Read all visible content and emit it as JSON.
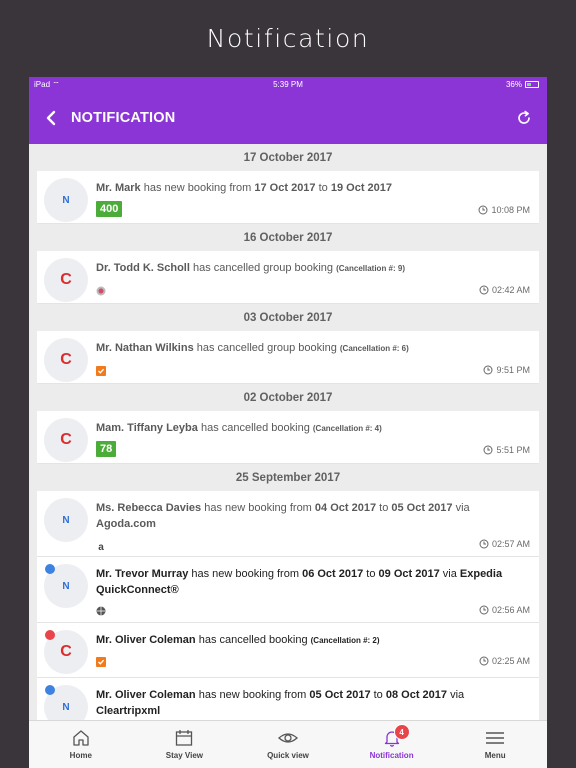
{
  "page_heading": "Notification",
  "status_bar": {
    "device": "iPad",
    "time": "5:39 PM",
    "battery": "36%"
  },
  "app_bar": {
    "title": "NOTIFICATION"
  },
  "groups": [
    {
      "date": "17 October 2017"
    },
    {
      "date": "16 October 2017"
    },
    {
      "date": "03 October 2017"
    },
    {
      "date": "02 October 2017"
    },
    {
      "date": "25 September 2017"
    }
  ],
  "notifications": [
    {
      "initial": "N",
      "name": "Mr. Mark",
      "text1": "has new booking from",
      "from": "17 Oct 2017",
      "to_word": "to",
      "to": "19 Oct 2017",
      "badge": "400",
      "time": "10:08 PM"
    },
    {
      "initial": "C",
      "name": "Dr. Todd K. Scholl",
      "text1": "has cancelled group booking",
      "cancel": "(Cancellation #: 9)",
      "time": "02:42 AM",
      "source_icon": "booking-engine-icon"
    },
    {
      "initial": "C",
      "name": "Mr. Nathan Wilkins",
      "text1": "has cancelled group booking",
      "cancel": "(Cancellation #: 6)",
      "time": "9:51 PM",
      "source_icon": "check-icon"
    },
    {
      "initial": "C",
      "name": "Mam. Tiffany Leyba",
      "text1": "has cancelled booking",
      "cancel": "(Cancellation #: 4)",
      "badge": "78",
      "time": "5:51 PM"
    },
    {
      "initial": "N",
      "name": "Ms. Rebecca Davies",
      "text1": "has new booking from",
      "from": "04 Oct 2017",
      "to_word": "to",
      "to": "05 Oct 2017",
      "via_word": "via",
      "via": "Agoda.com",
      "time": "02:57 AM",
      "source_icon": "agoda-icon"
    },
    {
      "initial": "N",
      "name": "Mr. Trevor Murray",
      "text1": "has new booking from",
      "from": "06 Oct 2017",
      "to_word": "to",
      "to": "09 Oct 2017",
      "via_word": "via",
      "via": "Expedia QuickConnect®",
      "time": "02:56 AM",
      "source_icon": "globe-icon",
      "unread": true,
      "dot_color": "#3d82e0"
    },
    {
      "initial": "C",
      "name": "Mr. Oliver Coleman",
      "text1": "has cancelled booking",
      "cancel": "(Cancellation #: 2)",
      "time": "02:25 AM",
      "source_icon": "check-icon",
      "unread": true,
      "dot_color": "#e8454a"
    },
    {
      "initial": "N",
      "name": "Mr. Oliver Coleman",
      "text1": "has new booking from",
      "from": "05 Oct 2017",
      "to_word": "to",
      "to": "08 Oct 2017",
      "via_word": "via",
      "via": "Cleartripxml",
      "unread": true,
      "dot_color": "#3d82e0"
    }
  ],
  "tabs": [
    {
      "label": "Home",
      "icon": "home-icon"
    },
    {
      "label": "Stay View",
      "icon": "calendar-icon"
    },
    {
      "label": "Quick view",
      "icon": "eye-icon"
    },
    {
      "label": "Notification",
      "icon": "bell-icon",
      "badge": "4",
      "active": true
    },
    {
      "label": "Menu",
      "icon": "menu-icon"
    }
  ],
  "colors": {
    "accent": "#8b35d6",
    "badge_green": "#4cac3a",
    "cancel_red": "#e02a2a",
    "new_blue": "#2f6fd4"
  }
}
